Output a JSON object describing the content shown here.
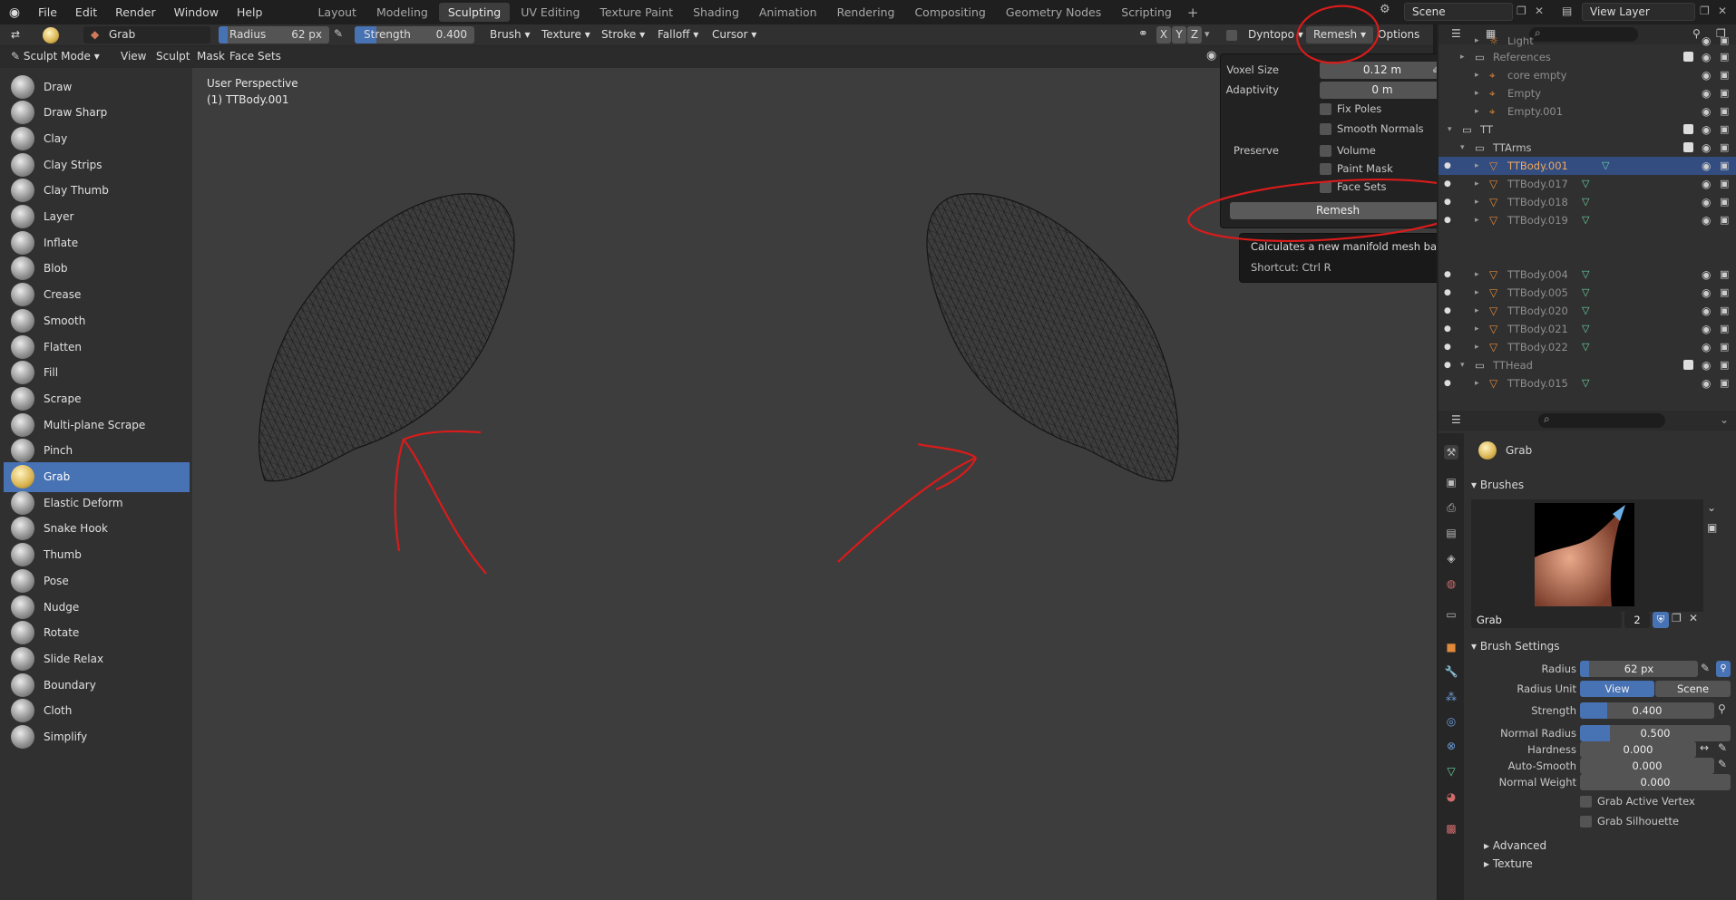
{
  "menubar": {
    "items": [
      "File",
      "Edit",
      "Render",
      "Window",
      "Help"
    ],
    "workspaces": [
      "Layout",
      "Modeling",
      "Sculpting",
      "UV Editing",
      "Texture Paint",
      "Shading",
      "Animation",
      "Rendering",
      "Compositing",
      "Geometry Nodes",
      "Scripting"
    ],
    "active_workspace": "Sculpting",
    "add_tab": "+",
    "scene": "Scene",
    "view_layer": "View Layer"
  },
  "toolbar": {
    "brush_name": "Grab",
    "radius_label": "Radius",
    "radius_value": "62 px",
    "strength_label": "Strength",
    "strength_value": "0.400",
    "brush": "Brush",
    "texture": "Texture",
    "stroke": "Stroke",
    "falloff": "Falloff",
    "cursor": "Cursor",
    "axes": [
      "X",
      "Y",
      "Z"
    ],
    "dyntopo": "Dyntopo",
    "remesh": "Remesh",
    "options": "Options"
  },
  "header2": {
    "mode": "Sculpt Mode",
    "menus": [
      "View",
      "Sculpt",
      "Mask",
      "Face Sets"
    ]
  },
  "tools": [
    "Draw",
    "Draw Sharp",
    "Clay",
    "Clay Strips",
    "Clay Thumb",
    "Layer",
    "Inflate",
    "Blob",
    "Crease",
    "Smooth",
    "Flatten",
    "Fill",
    "Scrape",
    "Multi-plane Scrape",
    "Pinch",
    "Grab",
    "Elastic Deform",
    "Snake Hook",
    "Thumb",
    "Pose",
    "Nudge",
    "Rotate",
    "Slide Relax",
    "Boundary",
    "Cloth",
    "Simplify"
  ],
  "active_tool": "Grab",
  "viewport": {
    "perspective": "User Perspective",
    "object": "(1) TTBody.001"
  },
  "remesh_popover": {
    "voxel_size_label": "Voxel Size",
    "voxel_size_value": "0.12 m",
    "adaptivity_label": "Adaptivity",
    "adaptivity_value": "0 m",
    "fix_poles": "Fix Poles",
    "smooth_normals": "Smooth Normals",
    "preserve_label": "Preserve",
    "volume": "Volume",
    "paint_mask": "Paint Mask",
    "face_sets": "Face Sets",
    "remesh_button": "Remesh"
  },
  "tooltip": {
    "text": "Calculates a new manifold mesh based on the volume of the current mesh. All data layers will be lost.",
    "shortcut": "Shortcut: Ctrl R"
  },
  "outliner": {
    "rows": [
      {
        "name": "Light",
        "kind": "dim"
      },
      {
        "name": "References",
        "kind": "dim"
      },
      {
        "name": "core empty",
        "kind": "dim"
      },
      {
        "name": "Empty",
        "kind": "dim"
      },
      {
        "name": "Empty.001",
        "kind": "dim"
      },
      {
        "name": "TT",
        "kind": "normal"
      },
      {
        "name": "TTArms",
        "kind": "normal"
      },
      {
        "name": "TTBody.001",
        "kind": "selected"
      },
      {
        "name": "TTBody.017",
        "kind": "dim"
      },
      {
        "name": "TTBody.018",
        "kind": "dim"
      },
      {
        "name": "TTBody.019",
        "kind": "dim"
      },
      {
        "name": "TTBody.004",
        "kind": "dim"
      },
      {
        "name": "TTBody.005",
        "kind": "dim"
      },
      {
        "name": "TTBody.020",
        "kind": "dim"
      },
      {
        "name": "TTBody.021",
        "kind": "dim"
      },
      {
        "name": "TTBody.022",
        "kind": "dim"
      },
      {
        "name": "TTHead",
        "kind": "dim"
      },
      {
        "name": "TTBody.015",
        "kind": "dim"
      }
    ]
  },
  "properties": {
    "active_brush": "Grab",
    "brushes_section": "Brushes",
    "brush_field": "Grab",
    "brush_users": "2",
    "brush_settings_section": "Brush Settings",
    "radius_label": "Radius",
    "radius_value": "62 px",
    "radius_unit_label": "Radius Unit",
    "radius_unit_view": "View",
    "radius_unit_scene": "Scene",
    "strength_label": "Strength",
    "strength_value": "0.400",
    "strength_fraction": 0.4,
    "normal_radius_label": "Normal Radius",
    "normal_radius_value": "0.500",
    "normal_radius_fraction": 0.5,
    "hardness_label": "Hardness",
    "hardness_value": "0.000",
    "auto_smooth_label": "Auto-Smooth",
    "auto_smooth_value": "0.000",
    "normal_weight_label": "Normal Weight",
    "normal_weight_value": "0.000",
    "grab_active_vertex": "Grab Active Vertex",
    "grab_silhouette": "Grab Silhouette",
    "advanced_section": "Advanced",
    "texture_section": "Texture"
  },
  "colors": {
    "accent_blue": "#4772b3",
    "annotation_red": "#d91b1b",
    "selection_orange": "#f1a85b"
  }
}
